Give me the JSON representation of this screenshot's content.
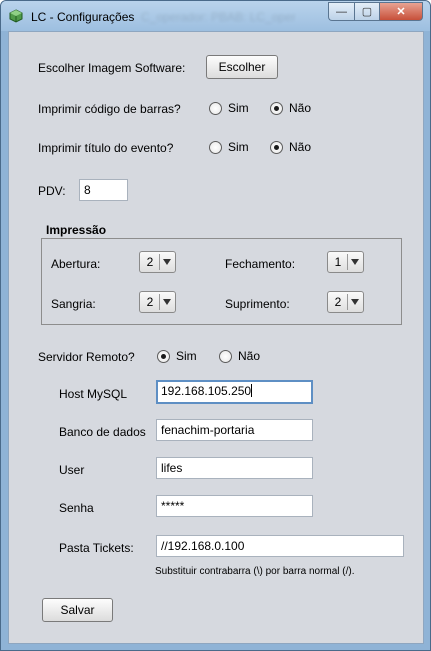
{
  "window": {
    "title": "LC - Configurações",
    "ghost_title": "C_operador: PBAB: LC_oper",
    "min_label": "—",
    "max_label": "▢",
    "close_label": "✕"
  },
  "software_image": {
    "label": "Escolher Imagem Software:",
    "button_label": "Escolher"
  },
  "print_barcode": {
    "label": "Imprimir código de barras?",
    "yes": "Sim",
    "no": "Não",
    "selected": "no"
  },
  "print_title": {
    "label": "Imprimir título do evento?",
    "yes": "Sim",
    "no": "Não",
    "selected": "no"
  },
  "pdv": {
    "label": "PDV:",
    "value": "8"
  },
  "impressao": {
    "title": "Impressão",
    "abertura": {
      "label": "Abertura:",
      "value": "2"
    },
    "fechamento": {
      "label": "Fechamento:",
      "value": "1"
    },
    "sangria": {
      "label": "Sangria:",
      "value": "2"
    },
    "suprimento": {
      "label": "Suprimento:",
      "value": "2"
    }
  },
  "remote_server": {
    "label": "Servidor Remoto?",
    "yes": "Sim",
    "no": "Não",
    "selected": "yes"
  },
  "host": {
    "label": "Host MySQL",
    "value": "192.168.105.250"
  },
  "database": {
    "label": "Banco de dados",
    "value": "fenachim-portaria"
  },
  "user": {
    "label": "User",
    "value": "lifes"
  },
  "password": {
    "label": "Senha",
    "value": "*****"
  },
  "tickets_folder": {
    "label": "Pasta Tickets:",
    "value": "//192.168.0.100"
  },
  "tickets_hint": "Substituir contrabarra (\\) por barra normal (/).",
  "save_button": "Salvar",
  "colors": {
    "client_bg": "#d6d9df",
    "focus_border": "#5e8fc4",
    "titlebar": "#9dbfe0"
  },
  "icons": {
    "app": "app-cube-icon",
    "combo_arrow": "chevron-down-icon"
  }
}
